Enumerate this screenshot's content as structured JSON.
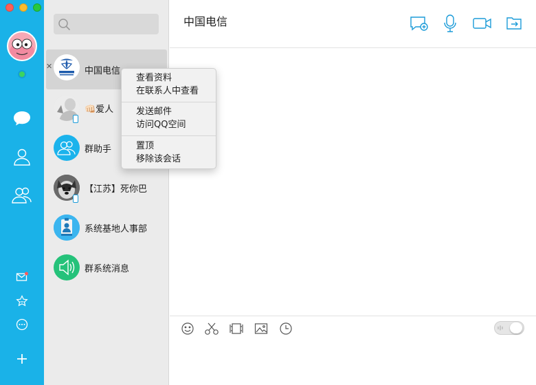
{
  "chat": {
    "title": "中国电信",
    "toolbar_icons": [
      "add-chat-icon",
      "microphone-icon",
      "video-camera-icon",
      "share-screen-icon"
    ],
    "composer_icons": [
      "emoji-icon",
      "scissors-icon",
      "film-icon",
      "image-icon",
      "clock-icon"
    ]
  },
  "conversations": [
    {
      "name": "中国电信",
      "selected": true,
      "icon": "china-telecom-logo"
    },
    {
      "name": "👊🏻爱人",
      "icon": "user-photo-avatar",
      "mobile": true
    },
    {
      "name": "群助手",
      "icon": "group-assistant-icon"
    },
    {
      "name": "【江苏】死你巴",
      "icon": "dog-photo-avatar",
      "mobile": true
    },
    {
      "name": "系统基地人事部",
      "icon": "id-badge-icon"
    },
    {
      "name": "群系统消息",
      "icon": "speaker-icon"
    }
  ],
  "context_menu": {
    "items": [
      "查看资料",
      "在联系人中查看",
      "发送邮件",
      "访问QQ空间",
      "置顶",
      "移除该会话"
    ]
  },
  "rail": {
    "icons": [
      "chat-bubble-icon",
      "contacts-icon",
      "groups-icon",
      "mail-icon",
      "favorites-icon",
      "more-icon",
      "add-icon"
    ]
  },
  "colors": {
    "rail": "#1ab2e8",
    "accent": "#1b9bd8",
    "online": "#3cd460",
    "group_icon_bg": "#1bb3ec",
    "system_icon_bg": "#25c27a"
  }
}
